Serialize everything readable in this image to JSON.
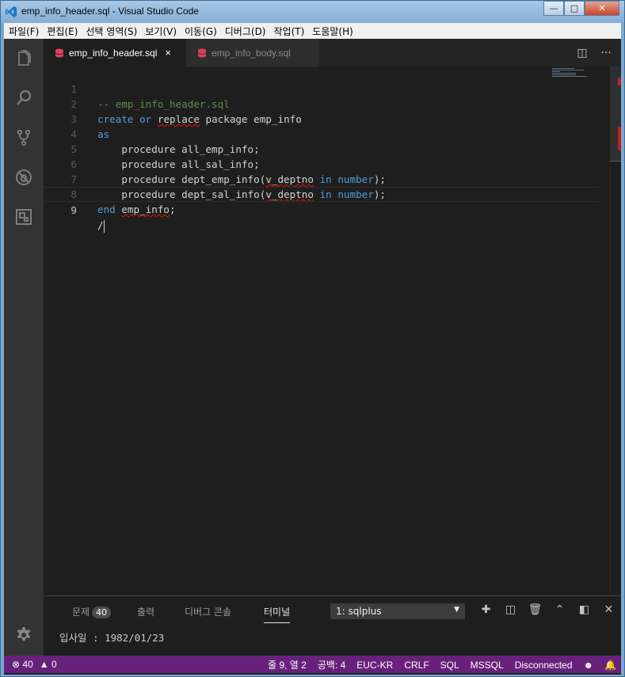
{
  "window": {
    "title": "emp_info_header.sql - Visual Studio Code",
    "controls": [
      "minimize",
      "maximize",
      "close"
    ]
  },
  "menu": [
    "파일(F)",
    "편집(E)",
    "선택 영역(S)",
    "보기(V)",
    "이동(G)",
    "디버그(D)",
    "작업(T)",
    "도움말(H)"
  ],
  "activity_bar": [
    "explorer-icon",
    "search-icon",
    "source-control-icon",
    "debug-icon",
    "extensions-icon",
    "gear-icon"
  ],
  "tabs": [
    {
      "label": "emp_info_header.sql",
      "active": true,
      "close": "×"
    },
    {
      "label": "emp_info_body.sql",
      "active": false
    }
  ],
  "tab_actions": [
    "split-editor-icon",
    "more-icon"
  ],
  "editor": {
    "lines": [
      {
        "n": "1",
        "text": "-- emp_info_header.sql"
      },
      {
        "n": "2",
        "text": "create or replace package emp_info"
      },
      {
        "n": "3",
        "text": "as"
      },
      {
        "n": "4",
        "text": "    procedure all_emp_info;"
      },
      {
        "n": "5",
        "text": "    procedure all_sal_info;"
      },
      {
        "n": "6",
        "text": "    procedure dept_emp_info(v_deptno in number);"
      },
      {
        "n": "7",
        "text": "    procedure dept_sal_info(v_deptno in number);"
      },
      {
        "n": "8",
        "text": "end emp_info;"
      },
      {
        "n": "9",
        "text": "/"
      }
    ],
    "current_line": "9"
  },
  "panel": {
    "tabs": [
      {
        "label": "문제",
        "badge": "40"
      },
      {
        "label": "출력"
      },
      {
        "label": "디버그 콘솔"
      },
      {
        "label": "터미널",
        "active": true
      }
    ],
    "terminal_select": "1: sqlplus",
    "terminal_output": "입사일 : 1982/01/23",
    "icons": [
      "plus-icon",
      "split-terminal-icon",
      "trash-icon",
      "chevron-up-icon",
      "maximize-panel-icon",
      "close-icon"
    ]
  },
  "status": {
    "errors": "40",
    "warnings": "0",
    "position": "줄 9, 열 2",
    "spaces": "공백: 4",
    "encoding": "EUC-KR",
    "eol": "CRLF",
    "language": "SQL",
    "connection_type": "MSSQL",
    "connection_state": "Disconnected"
  },
  "colors": {
    "status_bar": "#68217a",
    "editor_bg": "#1e1e1e",
    "keyword": "#569cd6",
    "comment": "#608b4e",
    "error": "#e51400"
  }
}
